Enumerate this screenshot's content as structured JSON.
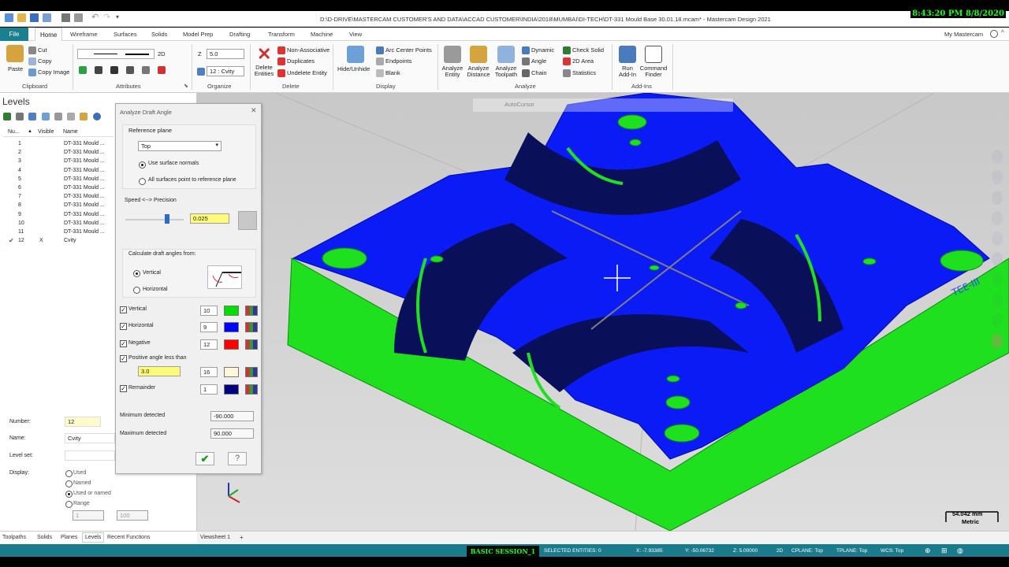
{
  "clock": "8:43:20 PM 8/8/2020",
  "window_title": "D:\\D-DRIVE\\MASTERCAM CUSTOMER'S AND DATA\\ACCAD CUSTOMER\\INDIA\\2018\\MUMBAI\\DI-TECH\\DT-331 Mould Base 30.01.18.mcam* - Mastercam Design 2021",
  "menu": {
    "file": "File",
    "tabs": [
      "Home",
      "Wireframe",
      "Surfaces",
      "Solids",
      "Model Prep",
      "Drafting",
      "Transform",
      "Machine",
      "View"
    ],
    "my_mastercam": "My Mastercam"
  },
  "ribbon": {
    "clipboard": {
      "paste": "Paste",
      "cut": "Cut",
      "copy": "Copy",
      "copy_image": "Copy Image",
      "label": "Clipboard"
    },
    "attributes": {
      "label": "Attributes",
      "dim": "2D"
    },
    "organize": {
      "label": "Organize",
      "z_label": "Z",
      "z_value": "5.0",
      "level_value": "12 : Cvity"
    },
    "delete": {
      "label": "Delete",
      "delete_entities": "Delete Entities",
      "non_assoc": "Non-Associative",
      "duplicates": "Duplicates",
      "undelete": "Undelete Entity"
    },
    "display": {
      "label": "Display",
      "hide": "Hide/Unhide",
      "arc_centers": "Arc Center Points",
      "endpoints": "Endpoints",
      "blank": "Blank"
    },
    "analyze": {
      "label": "Analyze",
      "entity": "Analyze Entity",
      "distance": "Analyze Distance",
      "toolpath": "Analyze Toolpath",
      "dynamic": "Dynamic",
      "angle": "Angle",
      "chain": "Chain",
      "check_solid": "Check Solid",
      "area": "2D Area",
      "statistics": "Statistics"
    },
    "addins": {
      "label": "Add-Ins",
      "run": "Run Add-In",
      "command_finder": "Command Finder"
    }
  },
  "levels_panel": {
    "title": "Levels",
    "col_number": "Nu...",
    "col_visible": "Visible",
    "col_name": "Name",
    "rows": [
      {
        "num": "1",
        "vis": "",
        "name": "DT-331 Mould ...",
        "active": false
      },
      {
        "num": "2",
        "vis": "",
        "name": "DT-331 Mould ...",
        "active": false
      },
      {
        "num": "3",
        "vis": "",
        "name": "DT-331 Mould ...",
        "active": false
      },
      {
        "num": "4",
        "vis": "",
        "name": "DT-331 Mould ...",
        "active": false
      },
      {
        "num": "5",
        "vis": "",
        "name": "DT-331 Mould ...",
        "active": false
      },
      {
        "num": "6",
        "vis": "",
        "name": "DT-331 Mould ...",
        "active": false
      },
      {
        "num": "7",
        "vis": "",
        "name": "DT-331 Mould ...",
        "active": false
      },
      {
        "num": "8",
        "vis": "",
        "name": "DT-331 Mould ...",
        "active": false
      },
      {
        "num": "9",
        "vis": "",
        "name": "DT-331 Mould ...",
        "active": false
      },
      {
        "num": "10",
        "vis": "",
        "name": "DT-331 Mould ...",
        "active": false
      },
      {
        "num": "11",
        "vis": "",
        "name": "DT-331 Mould ...",
        "active": false
      },
      {
        "num": "12",
        "vis": "X",
        "name": "Cvity",
        "active": true
      }
    ],
    "number_label": "Number:",
    "number_value": "12",
    "name_label": "Name:",
    "name_value": "Cvity",
    "levelset_label": "Level set:",
    "display_label": "Display:",
    "display_options": [
      "Used",
      "Named",
      "Used or named",
      "Range"
    ],
    "range_from": "1",
    "range_to": "100"
  },
  "dialog": {
    "title": "Analyze Draft Angle",
    "ref_plane_label": "Reference plane",
    "ref_plane_value": "Top",
    "use_normals": "Use surface normals",
    "all_surfaces": "All surfaces point to reference plane",
    "speed_label": "Speed <--> Precision",
    "precision_value": "0.025",
    "calc_label": "Calculate draft angles from:",
    "vertical": "Vertical",
    "horizontal": "Horizontal",
    "rows": [
      {
        "label": "Vertical",
        "value": "10",
        "color": "#00e000"
      },
      {
        "label": "Horizontal",
        "value": "9",
        "color": "#0000ff"
      },
      {
        "label": "Negative",
        "value": "12",
        "color": "#ff0000"
      },
      {
        "label": "Positive angle less than",
        "value": "16",
        "color": "#fff8d8",
        "angle": "3.0"
      },
      {
        "label": "Remainder",
        "value": "1",
        "color": "#000080"
      }
    ],
    "min_label": "Minimum detected",
    "min_value": "-90.000",
    "max_label": "Maximum detected",
    "max_value": "90.000"
  },
  "viewport": {
    "autocursor": "AutoCursor",
    "scale_value": "54.042 mm",
    "scale_unit": "Metric",
    "part_text": "TEE-III"
  },
  "bottom_tabs": [
    "Toolpaths",
    "Solids",
    "Planes",
    "Levels",
    "Recent Functions"
  ],
  "viewsheet": "Viewsheet 1",
  "status": {
    "session": "BASIC SESSION_1",
    "selected": "SELECTED ENTITIES: 0",
    "x": "X:   -7.93385",
    "y": "Y:   -50.06732",
    "z": "Z:   5.00000",
    "dim": "2D",
    "cplane": "CPLANE: Top",
    "tplane": "TPLANE: Top",
    "wcs": "WCS: Top"
  }
}
